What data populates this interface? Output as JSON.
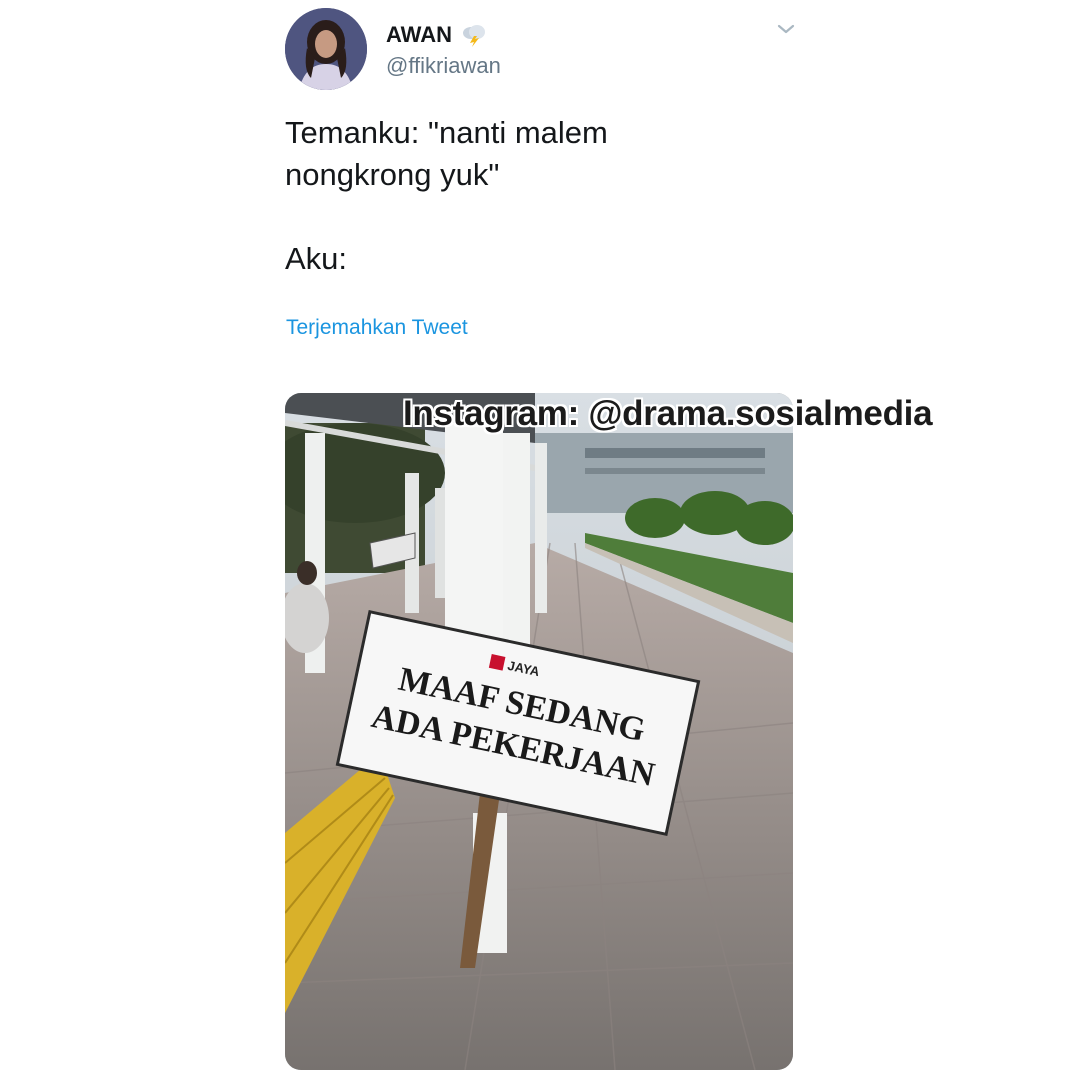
{
  "tweet": {
    "author": {
      "display_name": "AWAN",
      "handle": "@ffikriawan",
      "name_emoji_icon": "cloud-lightning-icon",
      "avatar_icon": "avatar"
    },
    "menu_icon": "chevron-down-icon",
    "text_lines": [
      "Temanku: \"nanti malem",
      "nongkrong yuk\"",
      "",
      "Aku:"
    ],
    "translate_label": "Terjemahkan Tweet",
    "media": {
      "sign_logo": "JAYA",
      "sign_lines": [
        "MAAF SEDANG",
        "ADA PEKERJAAN"
      ]
    }
  },
  "watermark": "Instagram: @drama.sosialmedia",
  "colors": {
    "text": "#14171a",
    "secondary": "#657786",
    "link": "#1b95e0",
    "tactile_paving": "#d9b12a",
    "sign_logo_red": "#c8102e"
  }
}
